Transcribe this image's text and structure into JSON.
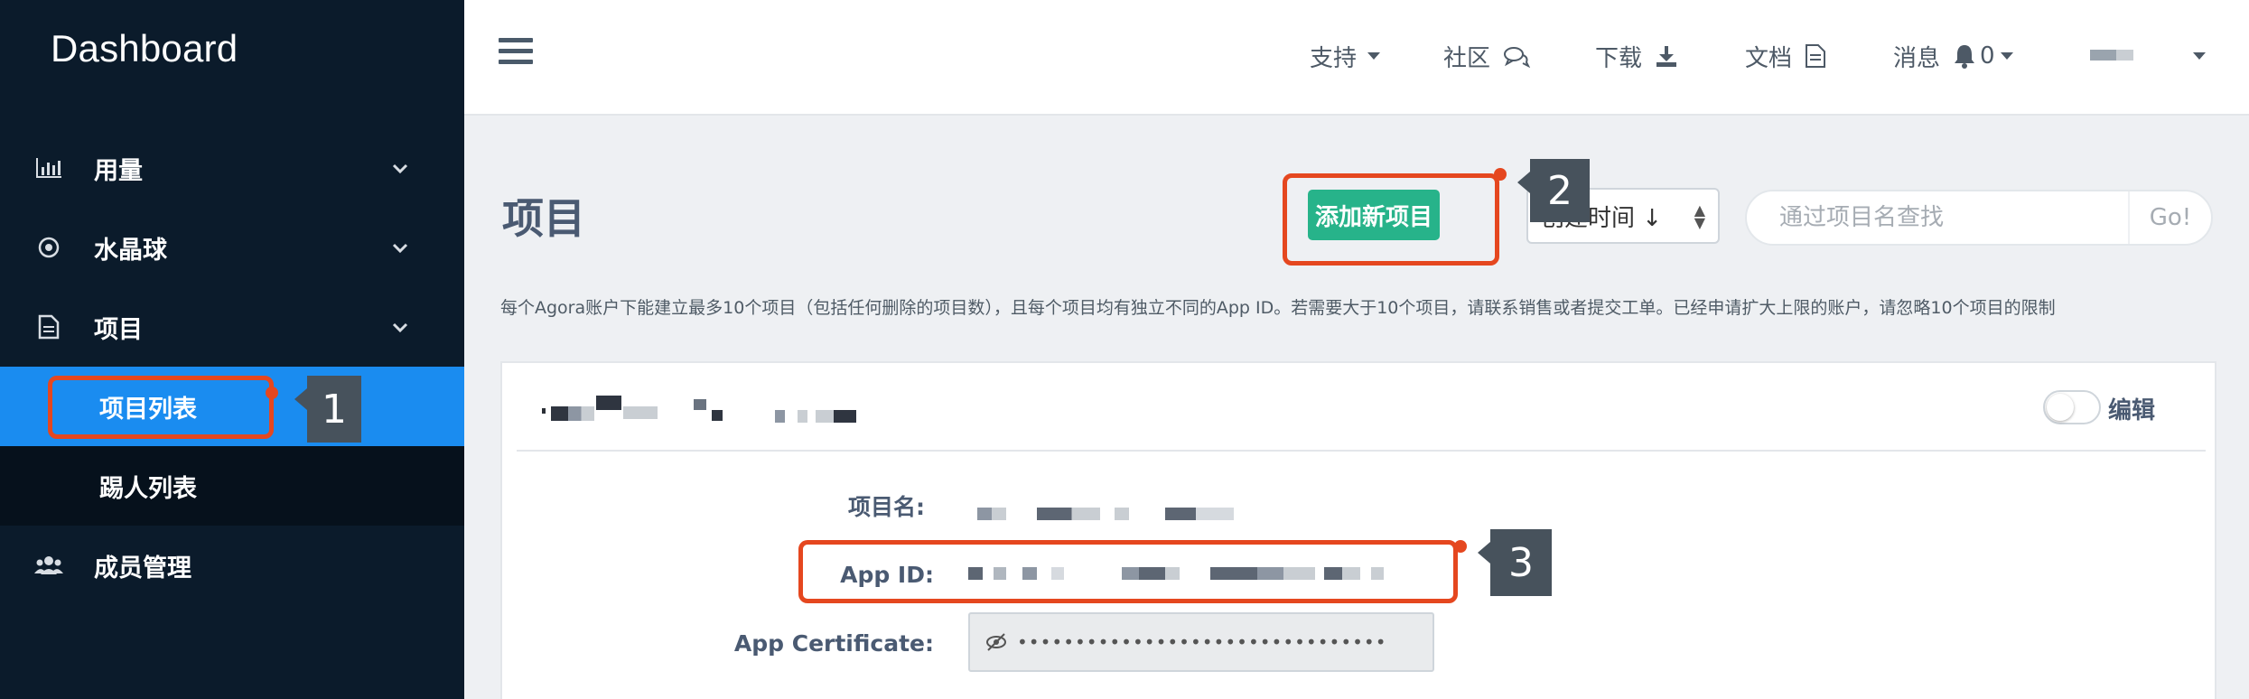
{
  "sidebar": {
    "brand": "Dashboard",
    "items": [
      {
        "label": "用量",
        "icon": "bar-chart-icon",
        "expandable": true
      },
      {
        "label": "水晶球",
        "icon": "target-icon",
        "expandable": true
      },
      {
        "label": "项目",
        "icon": "document-icon",
        "expandable": true
      },
      {
        "label": "成员管理",
        "icon": "users-icon",
        "expandable": false
      }
    ],
    "sub_items": [
      {
        "label": "项目列表",
        "active": true
      },
      {
        "label": "踢人列表",
        "active": false
      }
    ]
  },
  "topbar": {
    "menu_icon": "hamburger-icon",
    "nav": [
      {
        "label": "支持",
        "icon": "caret-down-icon"
      },
      {
        "label": "社区",
        "icon": "chat-icon"
      },
      {
        "label": "下载",
        "icon": "download-icon"
      },
      {
        "label": "文档",
        "icon": "file-icon"
      },
      {
        "label": "消息",
        "icon": "bell-icon",
        "count": "0"
      }
    ]
  },
  "main": {
    "title": "项目",
    "add_button": "添加新项目",
    "sort_select": "创建时间 ↓",
    "search_placeholder": "通过项目名查找",
    "go_label": "Go!",
    "notice": "每个Agora账户下能建立最多10个项目（包括任何删除的项目数），且每个项目均有独立不同的App ID。若需要大于10个项目，请联系销售或者提交工单。已经申请扩大上限的账户，请忽略10个项目的限制",
    "card": {
      "edit_label": "编辑",
      "fields": {
        "project_name_label": "项目名:",
        "app_id_label": "App ID:",
        "app_certificate_label": "App Certificate:",
        "app_certificate_value": "••••••••••••••••••••••••••••••••"
      }
    }
  },
  "annotations": {
    "tag1": "1",
    "tag2": "2",
    "tag3": "3",
    "highlight_color": "#e5471f"
  },
  "colors": {
    "sidebar_bg": "#0b1b2b",
    "active_item": "#1a8cf0",
    "primary_button": "#27b38a"
  }
}
